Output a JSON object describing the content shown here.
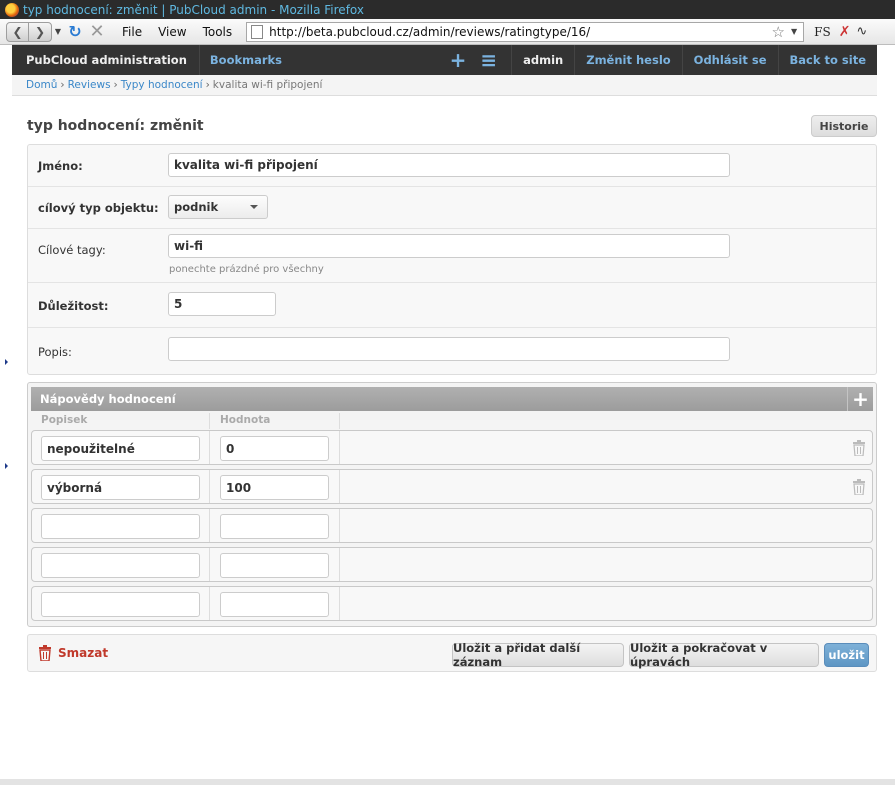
{
  "window": {
    "title": "typ hodnocení: změnit | PubCloud admin - Mozilla Firefox"
  },
  "browser": {
    "menu": [
      "File",
      "View",
      "Tools"
    ],
    "url": "http://beta.pubcloud.cz/admin/reviews/ratingtype/16/",
    "addon_fs": "FS"
  },
  "header": {
    "brand": "PubCloud administration",
    "bookmarks": "Bookmarks",
    "user": "admin",
    "change_password": "Změnit heslo",
    "logout": "Odhlásit se",
    "back_to_site": "Back to site"
  },
  "breadcrumbs": {
    "home": "Domů",
    "reviews": "Reviews",
    "types": "Typy hodnocení",
    "current": "kvalita wi-fi připojení"
  },
  "page": {
    "title": "typ hodnocení: změnit",
    "history_button": "Historie"
  },
  "form": {
    "name_label": "Jméno:",
    "name_value": "kvalita wi-fi připojení",
    "target_label": "cílový typ objektu:",
    "target_value": "podnik",
    "tags_label": "Cílové tagy:",
    "tags_value": "wi-fi",
    "tags_help": "ponechte prázdné pro všechny",
    "importance_label": "Důležitost:",
    "importance_value": "5",
    "description_label": "Popis:",
    "description_value": ""
  },
  "inline": {
    "title": "Nápovědy hodnocení",
    "col_label": "Popisek",
    "col_value": "Hodnota",
    "rows": [
      {
        "label": "nepoužitelné",
        "value": "0"
      },
      {
        "label": "výborná",
        "value": "100"
      },
      {
        "label": "",
        "value": ""
      },
      {
        "label": "",
        "value": ""
      },
      {
        "label": "",
        "value": ""
      }
    ]
  },
  "submit": {
    "delete": "Smazat",
    "save_add": "Uložit a přidat další záznam",
    "save_continue": "Uložit a pokračovat v úpravách",
    "save": "uložit"
  },
  "colors": {
    "accent": "#5e96c4",
    "delete": "#c0392b",
    "header_bg": "#333333",
    "link": "#3a87c8"
  }
}
